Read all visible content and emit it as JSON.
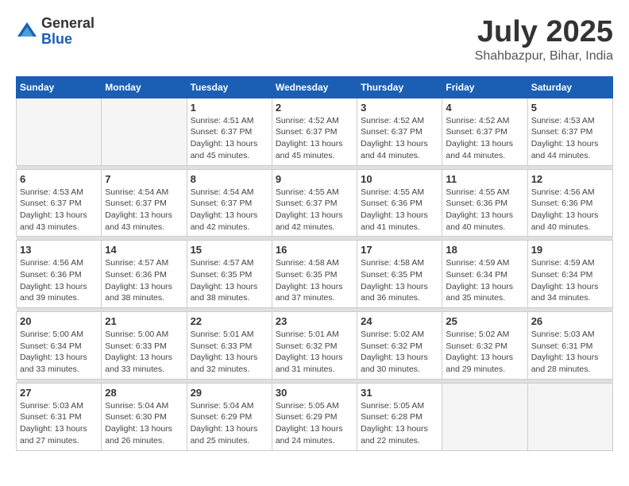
{
  "logo": {
    "general": "General",
    "blue": "Blue"
  },
  "title": {
    "month_year": "July 2025",
    "location": "Shahbazpur, Bihar, India"
  },
  "days_of_week": [
    "Sunday",
    "Monday",
    "Tuesday",
    "Wednesday",
    "Thursday",
    "Friday",
    "Saturday"
  ],
  "weeks": [
    [
      {
        "day": "",
        "info": ""
      },
      {
        "day": "",
        "info": ""
      },
      {
        "day": "1",
        "info": "Sunrise: 4:51 AM\nSunset: 6:37 PM\nDaylight: 13 hours\nand 45 minutes."
      },
      {
        "day": "2",
        "info": "Sunrise: 4:52 AM\nSunset: 6:37 PM\nDaylight: 13 hours\nand 45 minutes."
      },
      {
        "day": "3",
        "info": "Sunrise: 4:52 AM\nSunset: 6:37 PM\nDaylight: 13 hours\nand 44 minutes."
      },
      {
        "day": "4",
        "info": "Sunrise: 4:52 AM\nSunset: 6:37 PM\nDaylight: 13 hours\nand 44 minutes."
      },
      {
        "day": "5",
        "info": "Sunrise: 4:53 AM\nSunset: 6:37 PM\nDaylight: 13 hours\nand 44 minutes."
      }
    ],
    [
      {
        "day": "6",
        "info": "Sunrise: 4:53 AM\nSunset: 6:37 PM\nDaylight: 13 hours\nand 43 minutes."
      },
      {
        "day": "7",
        "info": "Sunrise: 4:54 AM\nSunset: 6:37 PM\nDaylight: 13 hours\nand 43 minutes."
      },
      {
        "day": "8",
        "info": "Sunrise: 4:54 AM\nSunset: 6:37 PM\nDaylight: 13 hours\nand 42 minutes."
      },
      {
        "day": "9",
        "info": "Sunrise: 4:55 AM\nSunset: 6:37 PM\nDaylight: 13 hours\nand 42 minutes."
      },
      {
        "day": "10",
        "info": "Sunrise: 4:55 AM\nSunset: 6:36 PM\nDaylight: 13 hours\nand 41 minutes."
      },
      {
        "day": "11",
        "info": "Sunrise: 4:55 AM\nSunset: 6:36 PM\nDaylight: 13 hours\nand 40 minutes."
      },
      {
        "day": "12",
        "info": "Sunrise: 4:56 AM\nSunset: 6:36 PM\nDaylight: 13 hours\nand 40 minutes."
      }
    ],
    [
      {
        "day": "13",
        "info": "Sunrise: 4:56 AM\nSunset: 6:36 PM\nDaylight: 13 hours\nand 39 minutes."
      },
      {
        "day": "14",
        "info": "Sunrise: 4:57 AM\nSunset: 6:36 PM\nDaylight: 13 hours\nand 38 minutes."
      },
      {
        "day": "15",
        "info": "Sunrise: 4:57 AM\nSunset: 6:35 PM\nDaylight: 13 hours\nand 38 minutes."
      },
      {
        "day": "16",
        "info": "Sunrise: 4:58 AM\nSunset: 6:35 PM\nDaylight: 13 hours\nand 37 minutes."
      },
      {
        "day": "17",
        "info": "Sunrise: 4:58 AM\nSunset: 6:35 PM\nDaylight: 13 hours\nand 36 minutes."
      },
      {
        "day": "18",
        "info": "Sunrise: 4:59 AM\nSunset: 6:34 PM\nDaylight: 13 hours\nand 35 minutes."
      },
      {
        "day": "19",
        "info": "Sunrise: 4:59 AM\nSunset: 6:34 PM\nDaylight: 13 hours\nand 34 minutes."
      }
    ],
    [
      {
        "day": "20",
        "info": "Sunrise: 5:00 AM\nSunset: 6:34 PM\nDaylight: 13 hours\nand 33 minutes."
      },
      {
        "day": "21",
        "info": "Sunrise: 5:00 AM\nSunset: 6:33 PM\nDaylight: 13 hours\nand 33 minutes."
      },
      {
        "day": "22",
        "info": "Sunrise: 5:01 AM\nSunset: 6:33 PM\nDaylight: 13 hours\nand 32 minutes."
      },
      {
        "day": "23",
        "info": "Sunrise: 5:01 AM\nSunset: 6:32 PM\nDaylight: 13 hours\nand 31 minutes."
      },
      {
        "day": "24",
        "info": "Sunrise: 5:02 AM\nSunset: 6:32 PM\nDaylight: 13 hours\nand 30 minutes."
      },
      {
        "day": "25",
        "info": "Sunrise: 5:02 AM\nSunset: 6:32 PM\nDaylight: 13 hours\nand 29 minutes."
      },
      {
        "day": "26",
        "info": "Sunrise: 5:03 AM\nSunset: 6:31 PM\nDaylight: 13 hours\nand 28 minutes."
      }
    ],
    [
      {
        "day": "27",
        "info": "Sunrise: 5:03 AM\nSunset: 6:31 PM\nDaylight: 13 hours\nand 27 minutes."
      },
      {
        "day": "28",
        "info": "Sunrise: 5:04 AM\nSunset: 6:30 PM\nDaylight: 13 hours\nand 26 minutes."
      },
      {
        "day": "29",
        "info": "Sunrise: 5:04 AM\nSunset: 6:29 PM\nDaylight: 13 hours\nand 25 minutes."
      },
      {
        "day": "30",
        "info": "Sunrise: 5:05 AM\nSunset: 6:29 PM\nDaylight: 13 hours\nand 24 minutes."
      },
      {
        "day": "31",
        "info": "Sunrise: 5:05 AM\nSunset: 6:28 PM\nDaylight: 13 hours\nand 22 minutes."
      },
      {
        "day": "",
        "info": ""
      },
      {
        "day": "",
        "info": ""
      }
    ]
  ]
}
